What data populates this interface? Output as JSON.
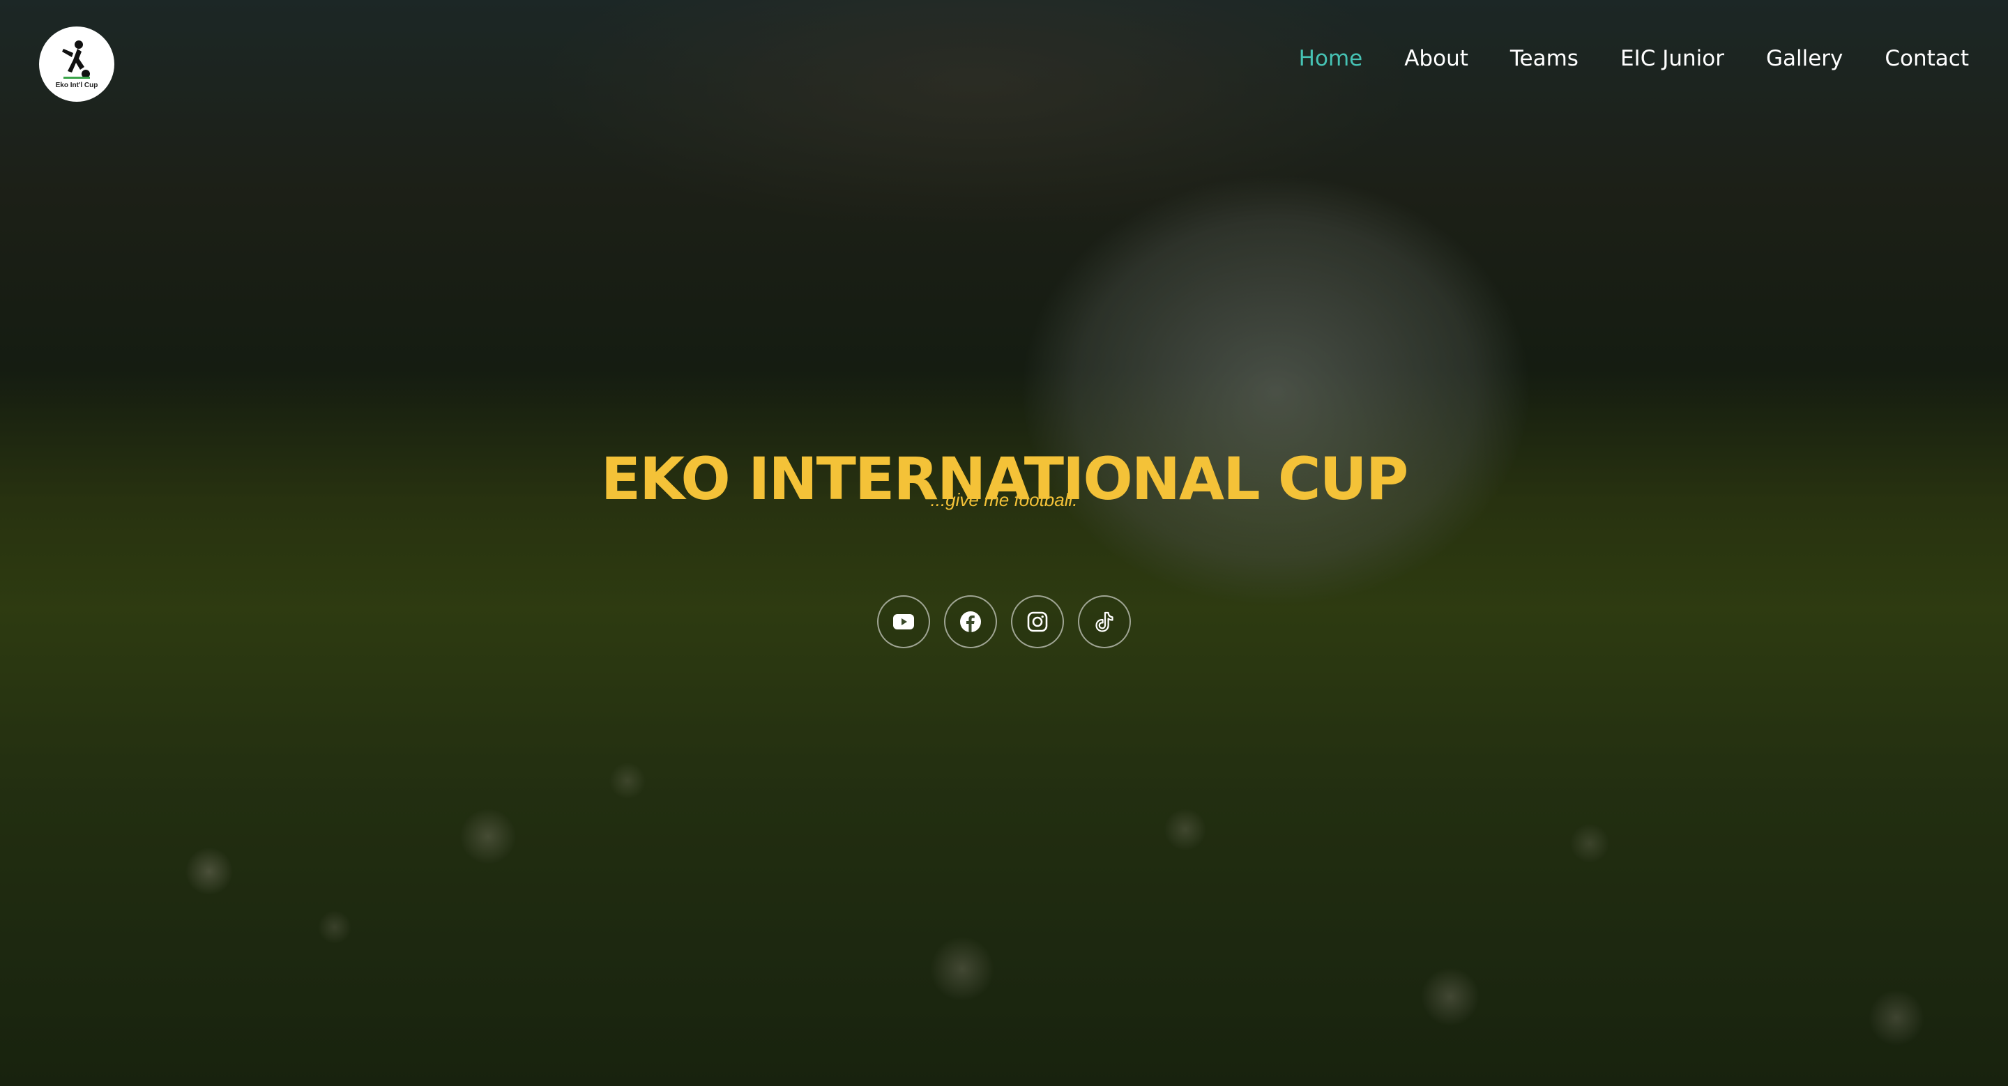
{
  "brand": {
    "logo_text": "Eko Int'l Cup"
  },
  "nav": {
    "items": [
      {
        "label": "Home",
        "active": true
      },
      {
        "label": "About",
        "active": false
      },
      {
        "label": "Teams",
        "active": false
      },
      {
        "label": "EIC Junior",
        "active": false
      },
      {
        "label": "Gallery",
        "active": false
      },
      {
        "label": "Contact",
        "active": false
      }
    ]
  },
  "hero": {
    "title": "EKO INTERNATIONAL CUP",
    "tagline": "...give me football."
  },
  "socials": [
    {
      "icon": "youtube-icon"
    },
    {
      "icon": "facebook-icon"
    },
    {
      "icon": "instagram-icon"
    },
    {
      "icon": "tiktok-icon"
    }
  ],
  "colors": {
    "accent_yellow": "#f4c238",
    "nav_active": "#46c2b4",
    "nav_text": "#ffffff"
  }
}
